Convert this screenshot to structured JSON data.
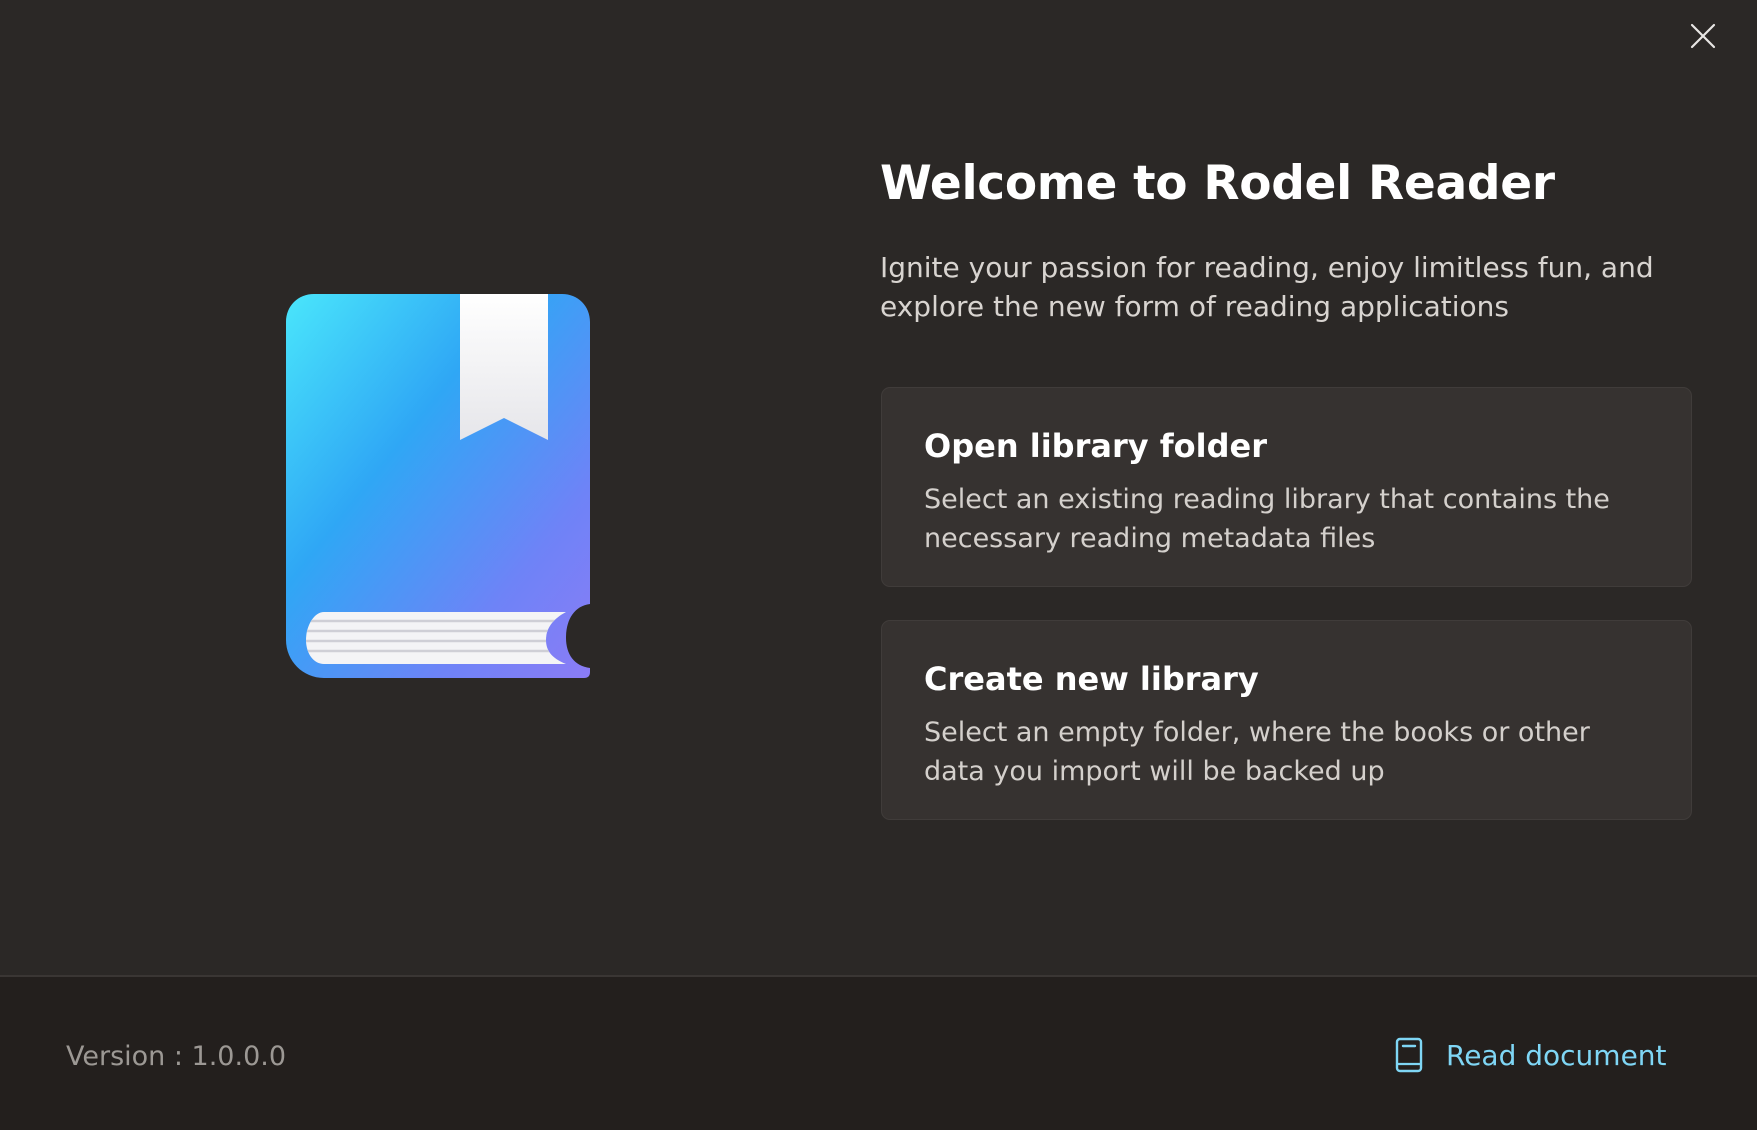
{
  "window": {
    "close_icon": "close-icon"
  },
  "hero": {
    "illustration": "book-with-bookmark-icon"
  },
  "welcome": {
    "title": "Welcome to Rodel Reader",
    "subtitle": "Ignite your passion for reading, enjoy limitless fun, and explore the new form of reading applications"
  },
  "cards": {
    "open": {
      "title": "Open library folder",
      "description": "Select an existing reading library that contains the necessary reading metadata files"
    },
    "create": {
      "title": "Create new library",
      "description": "Select an empty folder, where the books or other data you import will be backed up"
    }
  },
  "footer": {
    "version": "Version : 1.0.0.0",
    "read_document_label": "Read document",
    "read_document_icon": "book-icon"
  },
  "colors": {
    "background": "#2b2826",
    "card": "#363230",
    "footer": "#231f1d",
    "accent_link": "#7fd6f5",
    "book_gradient_start": "#4ae6fb",
    "book_gradient_end": "#8b7cf6"
  }
}
